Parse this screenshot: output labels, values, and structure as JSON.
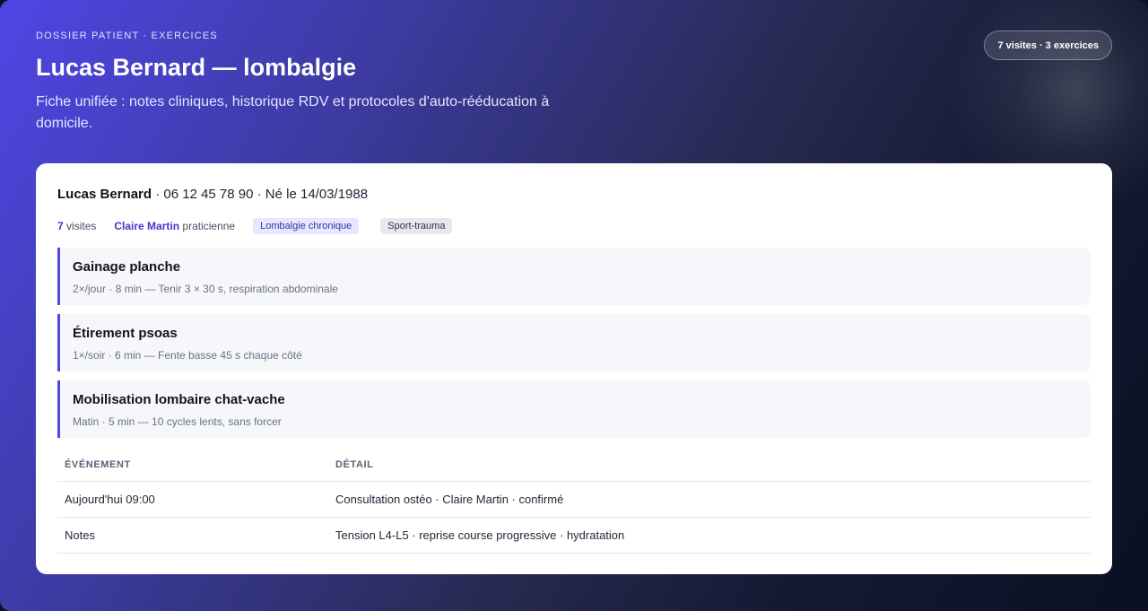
{
  "header": {
    "eyebrow": "DOSSIER PATIENT · EXERCICES",
    "title": "Lucas Bernard — lombalgie",
    "subtitle": "Fiche unifiée : notes cliniques, historique RDV et protocoles d'auto-rééducation à domicile.",
    "badge": "7 visites · 3 exercices"
  },
  "patient": {
    "name": "Lucas Bernard",
    "contact": " · 06 12 45 78 90 · Né le 14/03/1988",
    "visits_count": "7",
    "visits_label": " visites",
    "practitioner_name": "Claire Martin",
    "practitioner_role": " praticienne",
    "tags": [
      "Lombalgie chronique",
      "Sport-trauma"
    ]
  },
  "exercises": [
    {
      "title": "Gainage planche",
      "detail": "2×/jour · 8 min — Tenir 3 × 30 s, respiration abdominale"
    },
    {
      "title": "Étirement psoas",
      "detail": "1×/soir · 6 min — Fente basse 45 s chaque côté"
    },
    {
      "title": "Mobilisation lombaire chat-vache",
      "detail": "Matin · 5 min — 10 cycles lents, sans forcer"
    }
  ],
  "table": {
    "headers": [
      "ÉVÉNEMENT",
      "DÉTAIL"
    ],
    "rows": [
      [
        "Aujourd'hui 09:00",
        "Consultation ostéo · Claire Martin · confirmé"
      ],
      [
        "Notes",
        "Tension L4-L5 · reprise course progressive · hydratation"
      ]
    ]
  },
  "colors": {
    "accent": "#4f46e5",
    "accent_text": "#4338ca",
    "card_bg": "#ffffff"
  }
}
